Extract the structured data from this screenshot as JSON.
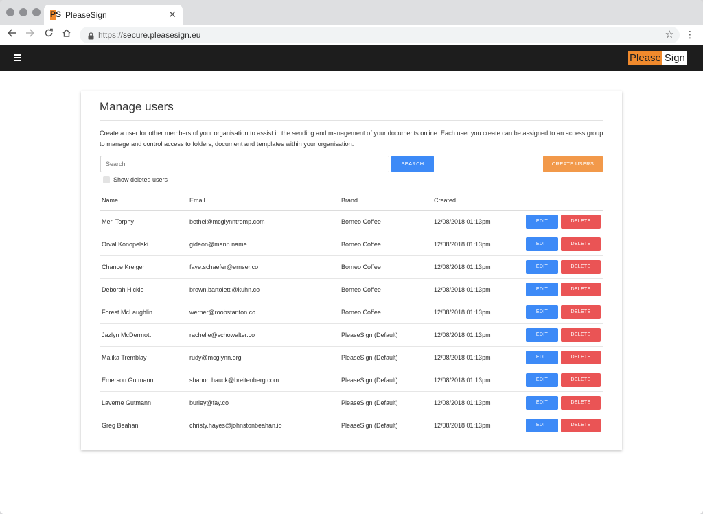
{
  "browser": {
    "tab_title": "PleaseSign",
    "favicon_text": "PS",
    "url_scheme": "https://",
    "url_host": "secure.pleasesign.eu"
  },
  "app": {
    "logo_please": "Please",
    "logo_sign": "Sign"
  },
  "page": {
    "title": "Manage users",
    "description": "Create a user for other members of your organisation to assist in the sending and management of your documents online. Each user you create can be assigned to an access group to manage and control access to folders, document and templates within your organisation.",
    "search_placeholder": "Search",
    "search_button": "SEARCH",
    "create_button": "CREATE USERS",
    "show_deleted_label": "Show deleted users",
    "show_deleted_checked": false
  },
  "table": {
    "headers": {
      "name": "Name",
      "email": "Email",
      "brand": "Brand",
      "created": "Created"
    },
    "edit_label": "EDIT",
    "delete_label": "DELETE",
    "rows": [
      {
        "name": "Merl Torphy",
        "email": "bethel@mcglynntromp.com",
        "brand": "Borneo Coffee",
        "created": "12/08/2018 01:13pm"
      },
      {
        "name": "Orval Konopelski",
        "email": "gideon@mann.name",
        "brand": "Borneo Coffee",
        "created": "12/08/2018 01:13pm"
      },
      {
        "name": "Chance Kreiger",
        "email": "faye.schaefer@ernser.co",
        "brand": "Borneo Coffee",
        "created": "12/08/2018 01:13pm"
      },
      {
        "name": "Deborah Hickle",
        "email": "brown.bartoletti@kuhn.co",
        "brand": "Borneo Coffee",
        "created": "12/08/2018 01:13pm"
      },
      {
        "name": "Forest McLaughlin",
        "email": "werner@roobstanton.co",
        "brand": "Borneo Coffee",
        "created": "12/08/2018 01:13pm"
      },
      {
        "name": "Jazlyn McDermott",
        "email": "rachelle@schowalter.co",
        "brand": "PleaseSign (Default)",
        "created": "12/08/2018 01:13pm"
      },
      {
        "name": "Malika Tremblay",
        "email": "rudy@mcglynn.org",
        "brand": "PleaseSign (Default)",
        "created": "12/08/2018 01:13pm"
      },
      {
        "name": "Emerson Gutmann",
        "email": "shanon.hauck@breitenberg.com",
        "brand": "PleaseSign (Default)",
        "created": "12/08/2018 01:13pm"
      },
      {
        "name": "Laverne Gutmann",
        "email": "burley@fay.co",
        "brand": "PleaseSign (Default)",
        "created": "12/08/2018 01:13pm"
      },
      {
        "name": "Greg Beahan",
        "email": "christy.hayes@johnstonbeahan.io",
        "brand": "PleaseSign (Default)",
        "created": "12/08/2018 01:13pm"
      }
    ]
  },
  "colors": {
    "primary_blue": "#3d8af7",
    "create_orange": "#f2994a",
    "delete_red": "#ea5455",
    "header_dark": "#1d1d1d",
    "brand_orange": "#f08a2d"
  }
}
